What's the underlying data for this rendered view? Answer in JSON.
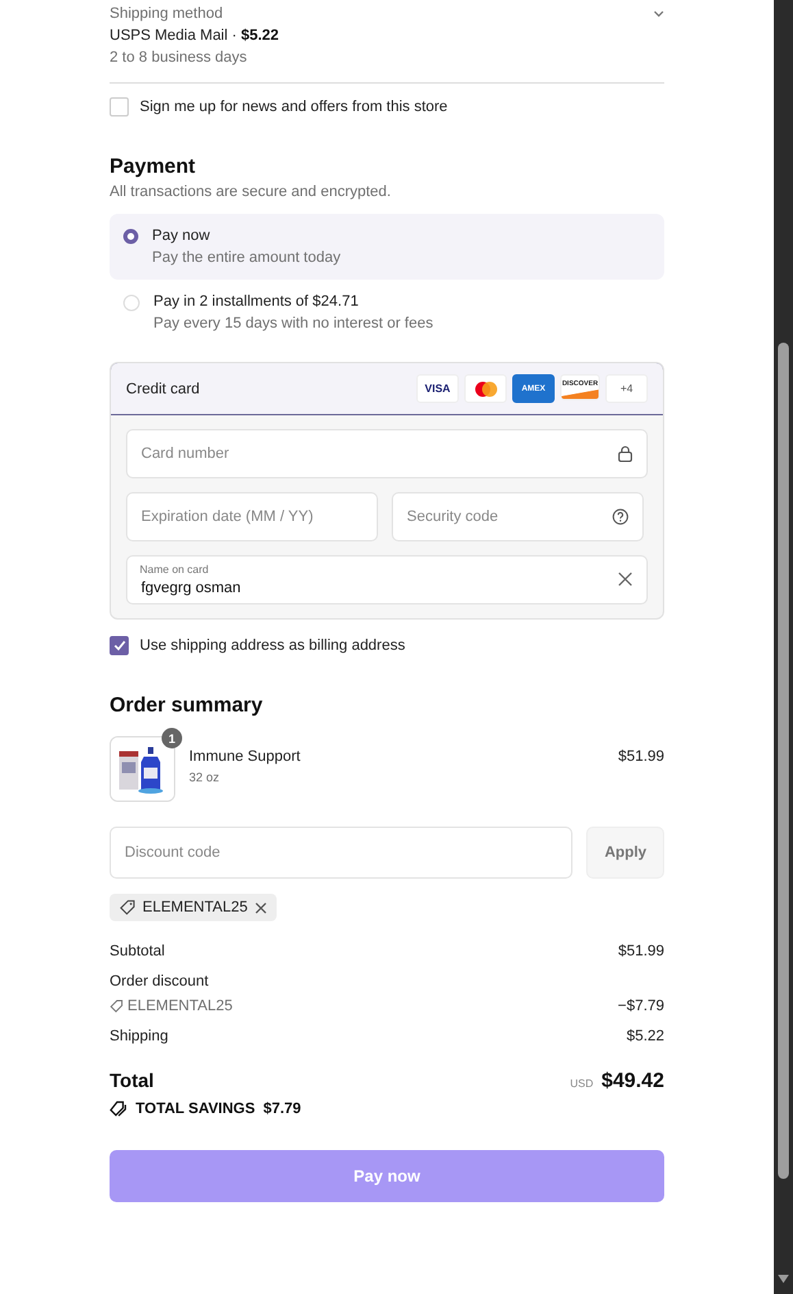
{
  "shipping": {
    "label": "Shipping method",
    "method": "USPS Media Mail",
    "separator": "·",
    "price": "$5.22",
    "eta": "2 to 8 business days",
    "expanded": false
  },
  "newsletter": {
    "label": "Sign me up for news and offers from this store",
    "checked": false
  },
  "payment": {
    "title": "Payment",
    "subtitle": "All transactions are secure and encrypted.",
    "options": [
      {
        "label": "Pay now",
        "detail": "Pay the entire amount today",
        "selected": true
      },
      {
        "label": "Pay in 2 installments of $24.71",
        "detail": "Pay every 15 days with no interest or fees",
        "selected": false
      }
    ],
    "method": {
      "label": "Credit card",
      "brands": [
        {
          "kind": "visa",
          "label": "VISA"
        },
        {
          "kind": "mastercard"
        },
        {
          "kind": "amex",
          "label": "AMEX"
        },
        {
          "kind": "discover",
          "label": "DISCOVER"
        },
        {
          "kind": "more",
          "label": "+4"
        }
      ],
      "fields": [
        {
          "kind": "card",
          "placeholder": "Card number"
        },
        {
          "kind": "expiry",
          "placeholder": "Expiration date (MM / YY)"
        },
        {
          "kind": "cvc",
          "placeholder": "Security code"
        },
        {
          "kind": "name",
          "label": "Name on card",
          "value": "fgvegrg osman"
        }
      ]
    },
    "billing": {
      "label": "Use shipping address as billing address",
      "checked": true
    }
  },
  "summary": {
    "title": "Order summary",
    "items": [
      {
        "quantity": "1",
        "name": "Immune Support",
        "variant": "32 oz",
        "price": "$51.99"
      }
    ],
    "discount": {
      "placeholder": "Discount code",
      "button": "Apply",
      "applied": [
        "ELEMENTAL25"
      ]
    },
    "lines": [
      {
        "kind": "plain",
        "label": "Subtotal",
        "value": "$51.99"
      },
      {
        "kind": "discount",
        "label": "Order discount",
        "code": "ELEMENTAL25",
        "value": "−$7.79"
      },
      {
        "kind": "plain",
        "label": "Shipping",
        "value": "$5.22"
      }
    ],
    "total": {
      "label": "Total",
      "currency": "USD",
      "value": "$49.42"
    },
    "savings": {
      "label": "TOTAL SAVINGS",
      "value": "$7.79"
    },
    "pay_button": "Pay now"
  }
}
